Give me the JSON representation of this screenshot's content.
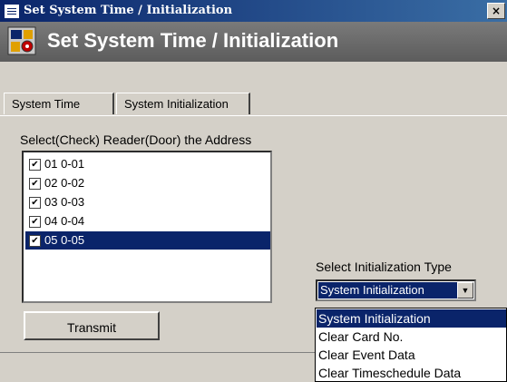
{
  "window": {
    "title": "Set System Time / Initialization",
    "close_glyph": "×"
  },
  "banner": {
    "title": "Set System Time / Initialization",
    "icon": "system-settings-icon"
  },
  "tabs": [
    {
      "label": "System Time",
      "active": false
    },
    {
      "label": "System Initialization",
      "active": true
    }
  ],
  "reader_select": {
    "label": "Select(Check) Reader(Door) the Address",
    "items": [
      {
        "label": "01 0-01",
        "checked": true,
        "selected": false
      },
      {
        "label": "02 0-02",
        "checked": true,
        "selected": false
      },
      {
        "label": "03 0-03",
        "checked": true,
        "selected": false
      },
      {
        "label": "04 0-04",
        "checked": true,
        "selected": false
      },
      {
        "label": "05 0-05",
        "checked": true,
        "selected": true
      }
    ]
  },
  "transmit_button": {
    "label": "Transmit"
  },
  "init_type": {
    "label": "Select Initialization Type",
    "selected": "System Initialization",
    "options": [
      "System Initialization",
      "Clear Card No.",
      "Clear Event Data",
      "Clear Timeschedule Data"
    ]
  },
  "colors": {
    "selection": "#0a246a",
    "face": "#d4d0c8",
    "banner": "#6e6e6e"
  }
}
